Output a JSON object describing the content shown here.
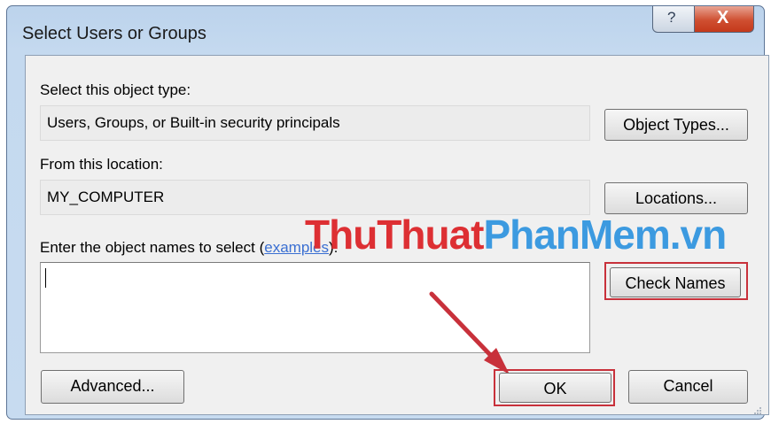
{
  "window": {
    "title": "Select Users or Groups",
    "help_glyph": "?",
    "close_glyph": "X"
  },
  "object_type": {
    "label": "Select this object type:",
    "value": "Users, Groups, or Built-in security principals",
    "button": "Object Types..."
  },
  "location": {
    "label": "From this location:",
    "value": "MY_COMPUTER",
    "button": "Locations..."
  },
  "names": {
    "label_prefix": "Enter the object names to select (",
    "link": "examples",
    "label_suffix": "):",
    "value": "",
    "check_button": "Check Names"
  },
  "footer": {
    "advanced": "Advanced...",
    "ok": "OK",
    "cancel": "Cancel"
  },
  "watermark": {
    "part1": "ThuThuat",
    "part2": "PhanMem.vn"
  },
  "colors": {
    "highlight": "#c8313b",
    "arrow": "#c8313b",
    "link": "#3a6fd2"
  }
}
